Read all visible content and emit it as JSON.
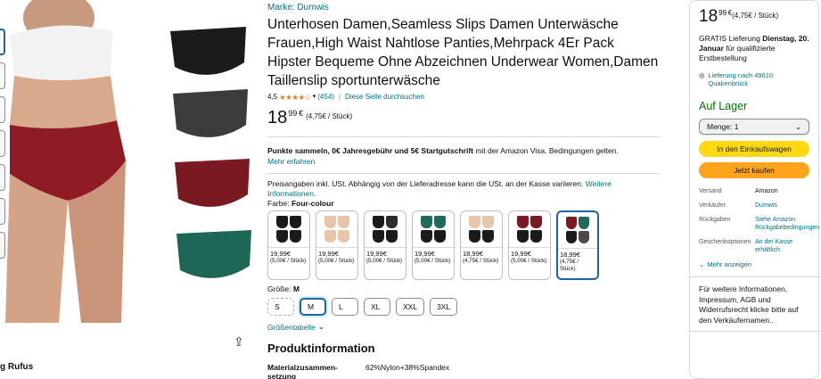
{
  "brand": "Marke: Dumwis",
  "title": "Unterhosen Damen,Seamless Slips Damen Unterwäsche Frauen,High Waist Nahtlose Panties,Mehrpack 4Er Pack Hipster Bequeme Ohne Abzeichnen Underwear Women,Damen Taillenslip sportunterwäsche",
  "rating": {
    "value": "4,5",
    "stars": "★★★★☆",
    "count": "(454)",
    "separator": "|",
    "search_link": "Diese Seite durchsuchen"
  },
  "price": {
    "integer": "18",
    "fraction": "99",
    "currency": "€",
    "unit": "(4,75€ / Stück)"
  },
  "promo": {
    "bold": "Punkte sammeln, 0€ Jahresgebühr und 5€ Startgutschrift",
    "rest": " mit der Amazon Visa. Bedingungen gelten.",
    "link": "Mehr erfahren"
  },
  "vat": {
    "text": "Preisangaben inkl. USt. Abhängig von der Lieferadresse kann die USt. an der Kasse variieren. ",
    "link": "Weitere Informationen."
  },
  "color": {
    "label": "Farbe: ",
    "value": "Four-colour"
  },
  "swatches": [
    {
      "price": "19,99€",
      "unit": "(5,00€ / Stück)",
      "colors": [
        "#1a1a1a",
        "#1a1a1a",
        "#1a1a1a",
        "#1a1a1a"
      ]
    },
    {
      "price": "19,99€",
      "unit": "(5,00€ / Stück)",
      "colors": [
        "#e8c4a8",
        "#e8c4a8",
        "#e8c4a8",
        "#e8c4a8"
      ]
    },
    {
      "price": "19,99€",
      "unit": "(5,00€ / Stück)",
      "colors": [
        "#1a1a1a",
        "#2b2b2b",
        "#1a1a1a",
        "#1a1a1a"
      ]
    },
    {
      "price": "19,99€",
      "unit": "(5,00€ / Stück)",
      "colors": [
        "#1f6a5a",
        "#1f6a5a",
        "#1a1a1a",
        "#1a1a1a"
      ]
    },
    {
      "price": "18,99€",
      "unit": "(4,75€ / Stück)",
      "colors": [
        "#e8c4a8",
        "#e8c4a8",
        "#1a1a1a",
        "#1a1a1a"
      ]
    },
    {
      "price": "19,99€",
      "unit": "(5,00€ / Stück)",
      "colors": [
        "#7a1a24",
        "#7a1a24",
        "#1a1a1a",
        "#1a1a1a"
      ]
    },
    {
      "price": "18,99€",
      "unit": "(4,75€ / Stück)",
      "colors": [
        "#7a1a24",
        "#1f6a5a",
        "#1a1a1a",
        "#4a4a4a"
      ]
    }
  ],
  "size": {
    "label": "Größe: ",
    "value": "M",
    "options": [
      "S",
      "M",
      "L",
      "XL",
      "XXL",
      "3XL"
    ],
    "table_link": "Größentabelle"
  },
  "product_info": {
    "heading": "Produktinformation",
    "rows": [
      {
        "key": "Materialzusammen-setzung",
        "value": "62%Nylon+38%Spandex"
      }
    ]
  },
  "byline": "g Rufus",
  "buybox": {
    "price_integer": "18",
    "price_fraction": "99",
    "currency": "€",
    "unit": "(4,75€ / Stück)",
    "ship_pre": "GRATIS Lieferung ",
    "ship_date": "Dienstag, 20. Januar",
    "ship_post": " für qualifizierte Erstbestellung",
    "location": "Lieferung nach 49610 Quakenbrück",
    "stock": "Auf Lager",
    "qty": "Menge: 1",
    "cart": "In den Einkaufswagen",
    "buy": "Jetzt kaufen",
    "meta": [
      {
        "k": "Versand",
        "v": "Amazon",
        "link": false
      },
      {
        "k": "Verkäufer",
        "v": "Dumwis",
        "link": true
      },
      {
        "k": "Rückgaben",
        "v": "Siehe Amazon Rückgabebedingungen",
        "link": true
      },
      {
        "k": "Geschenkoptionen",
        "v": "An der Kasse erhältlich",
        "link": true
      }
    ],
    "more": "Mehr anzeigen",
    "info": "Für weitere Informationen, Impressum, AGB und Widerrufsrecht klicke bitte auf den Verkäufernamen.."
  },
  "colors": {
    "link": "#007185",
    "stars": "#de7921",
    "cart": "#ffd814",
    "buy": "#ffa41c",
    "stock": "#007600",
    "selected": "#2162a1"
  }
}
